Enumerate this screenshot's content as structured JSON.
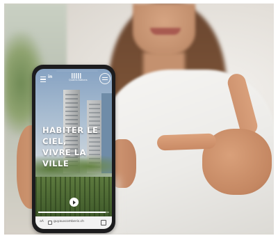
{
  "phone_screen": {
    "header": {
      "linkedin_label": "in",
      "logo_text": "Quatre-Nations"
    },
    "headline": {
      "line1": "HABITER LE",
      "line2": "CIEL,",
      "line3": "VIVRE LA",
      "line4": "VILLE"
    },
    "video": {
      "progress_fraction": 0.95
    },
    "browser": {
      "url": "guyauxcomberis.ch"
    }
  },
  "colors": {
    "phone_body": "#1c1c1e",
    "headline_text": "#ffffff",
    "shirt": "#f4f3f0"
  },
  "icons": [
    "menu-icon",
    "linkedin-icon",
    "logo-icon",
    "menu-circle-icon",
    "play-icon",
    "lock-icon",
    "tabs-icon"
  ]
}
